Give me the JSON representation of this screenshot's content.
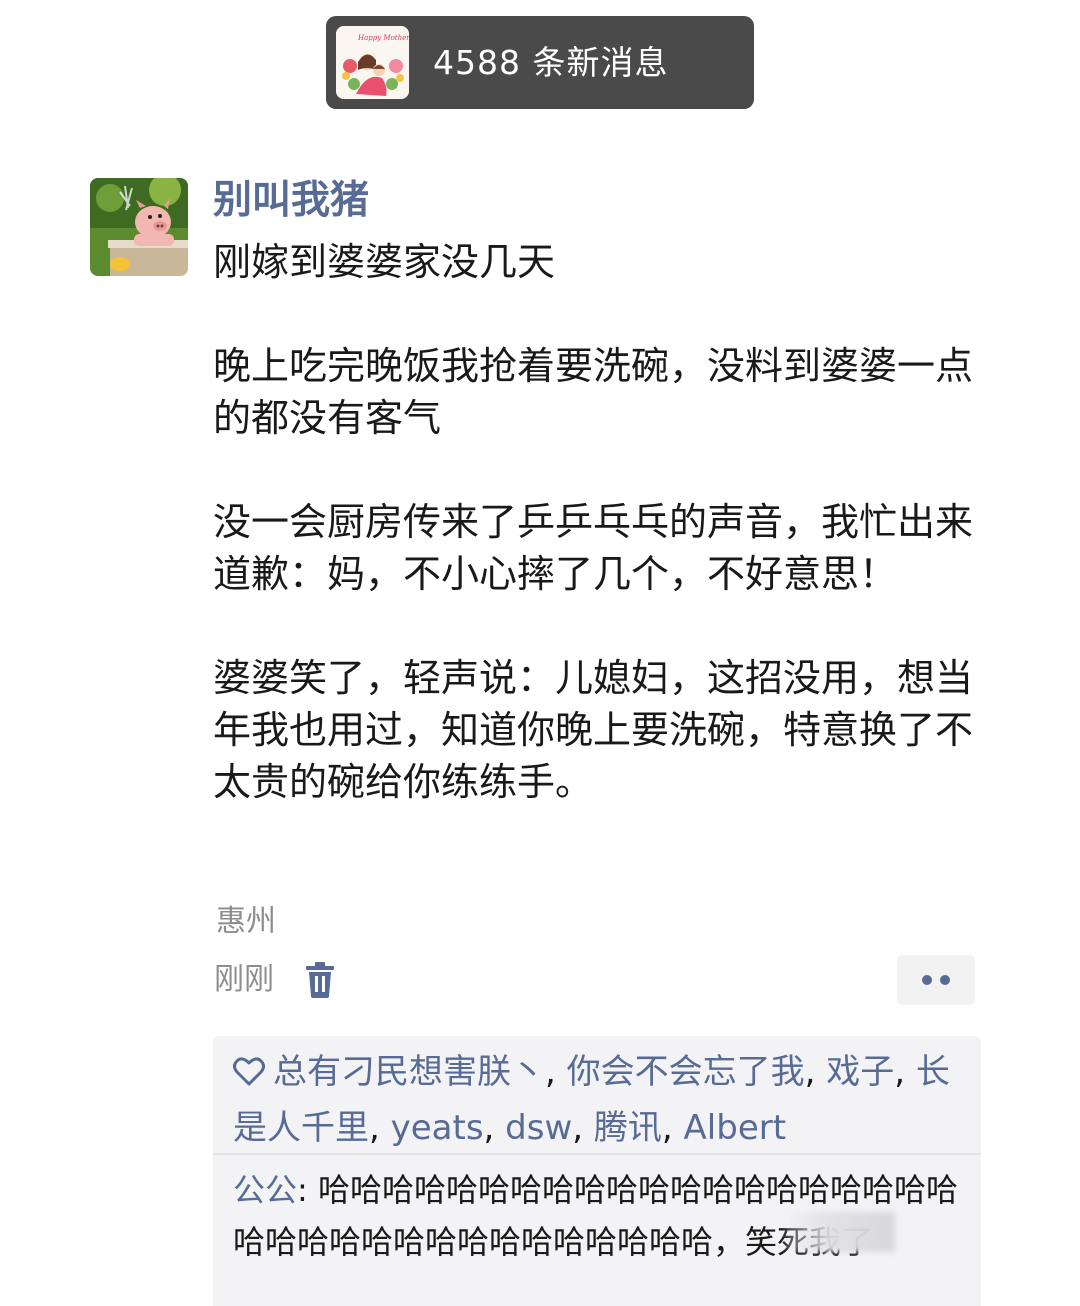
{
  "notification": {
    "text": "4588 条新消息",
    "avatar_caption": "Happy Mother's Day"
  },
  "post": {
    "author": "别叫我猪",
    "paragraphs": [
      "刚嫁到婆婆家没几天",
      "晚上吃完晚饭我抢着要洗碗，没料到婆婆一点的都没有客气",
      "没一会厨房传来了乒乒乓乓的声音，我忙出来道歉：妈，不小心摔了几个，不好意思！",
      "婆婆笑了，轻声说：儿媳妇，这招没用，想当年我也用过，知道你晚上要洗碗，特意换了不太贵的碗给你练练手。"
    ],
    "location": "惠州",
    "time": "刚刚"
  },
  "likes": {
    "names": [
      "总有刁民想害朕丶",
      "你会不会忘了我",
      "戏子",
      "长是人千里",
      "yeats",
      "dsw",
      "腾讯",
      "Albert"
    ],
    "separator": ", "
  },
  "comment": {
    "author": "公公",
    "colon": ": ",
    "text": "哈哈哈哈哈哈哈哈哈哈哈哈哈哈哈哈哈哈哈哈哈哈哈哈哈哈哈哈哈哈哈哈哈哈哈，笑死我了"
  },
  "icons": {
    "trash": "trash-icon",
    "more": "more-dots-icon",
    "heart": "heart-outline-icon"
  },
  "colors": {
    "link": "#576b95",
    "meta": "#8d8d8d",
    "notif_bg": "#4a4a4a"
  }
}
